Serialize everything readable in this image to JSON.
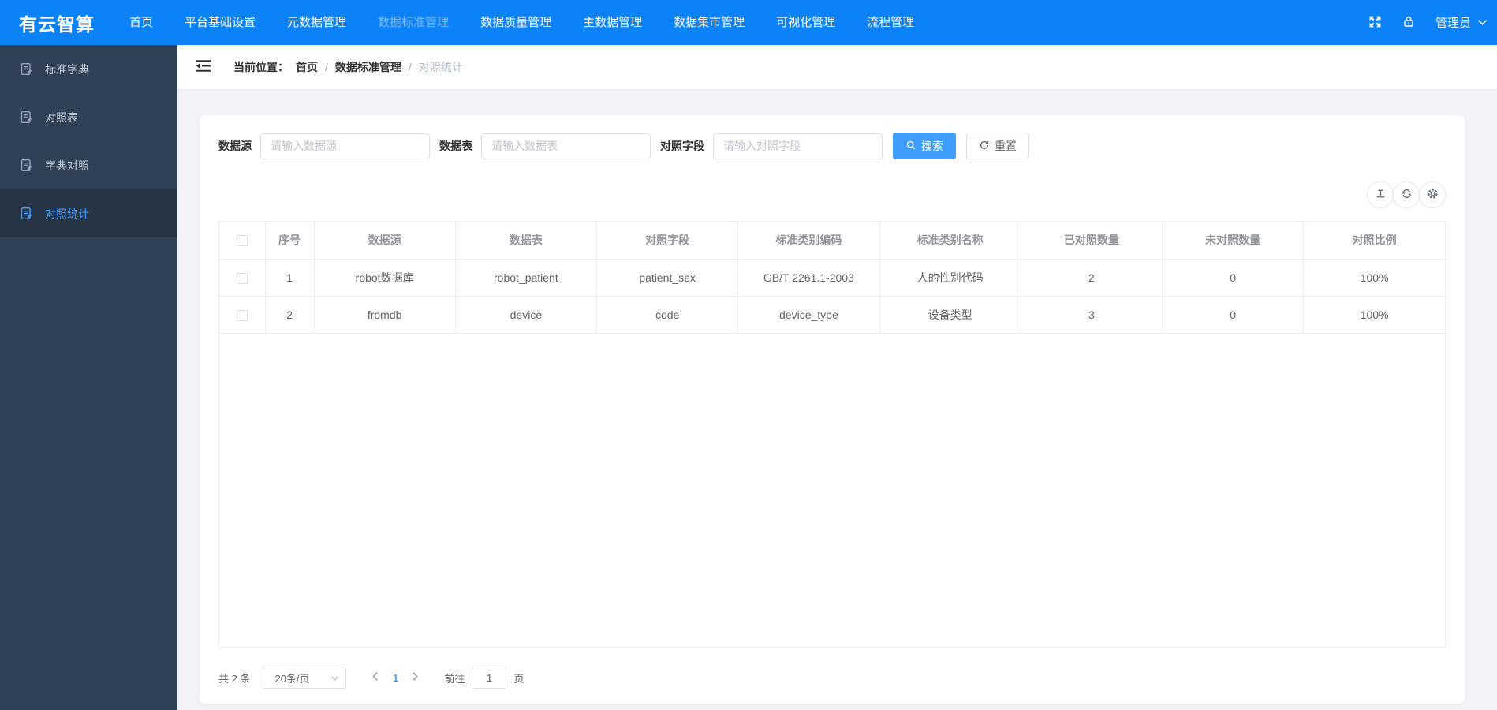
{
  "topbar": {
    "logo": "有云智算",
    "nav": [
      {
        "label": "首页"
      },
      {
        "label": "平台基础设置"
      },
      {
        "label": "元数据管理"
      },
      {
        "label": "数据标准管理"
      },
      {
        "label": "数据质量管理"
      },
      {
        "label": "主数据管理"
      },
      {
        "label": "数据集市管理"
      },
      {
        "label": "可视化管理"
      },
      {
        "label": "流程管理"
      }
    ],
    "user": {
      "name": "管理员"
    }
  },
  "sidebar": {
    "items": [
      {
        "label": "标准字典"
      },
      {
        "label": "对照表"
      },
      {
        "label": "字典对照"
      },
      {
        "label": "对照统计"
      }
    ]
  },
  "breadcrumb": {
    "prefix": "当前位置：",
    "separator": "/",
    "items": [
      {
        "label": "首页"
      },
      {
        "label": "数据标准管理"
      },
      {
        "label": "对照统计"
      }
    ]
  },
  "filters": {
    "fields": [
      {
        "label": "数据源",
        "placeholder": "请输入数据源",
        "value": ""
      },
      {
        "label": "数据表",
        "placeholder": "请输入数据表",
        "value": ""
      },
      {
        "label": "对照字段",
        "placeholder": "请输入对照字段",
        "value": ""
      }
    ],
    "search_label": "搜索",
    "reset_label": "重置"
  },
  "table": {
    "headers": [
      "序号",
      "数据源",
      "数据表",
      "对照字段",
      "标准类别编码",
      "标准类别名称",
      "已对照数量",
      "未对照数量",
      "对照比例"
    ],
    "rows": [
      [
        "1",
        "robot数据库",
        "robot_patient",
        "patient_sex",
        "GB/T 2261.1-2003",
        "人的性别代码",
        "2",
        "0",
        "100%"
      ],
      [
        "2",
        "fromdb",
        "device",
        "code",
        "device_type",
        "设备类型",
        "3",
        "0",
        "100%"
      ]
    ]
  },
  "pagination": {
    "total_text": "共 2 条",
    "page_size": "20条/页",
    "current_page": "1",
    "goto_label": "前往",
    "goto_value": "1",
    "goto_suffix": "页"
  },
  "colors": {
    "topbar_blue": "#0c82f8",
    "sidebar_dark": "#304156",
    "sidebar_active_bg": "#263445",
    "accent": "#409eff"
  }
}
